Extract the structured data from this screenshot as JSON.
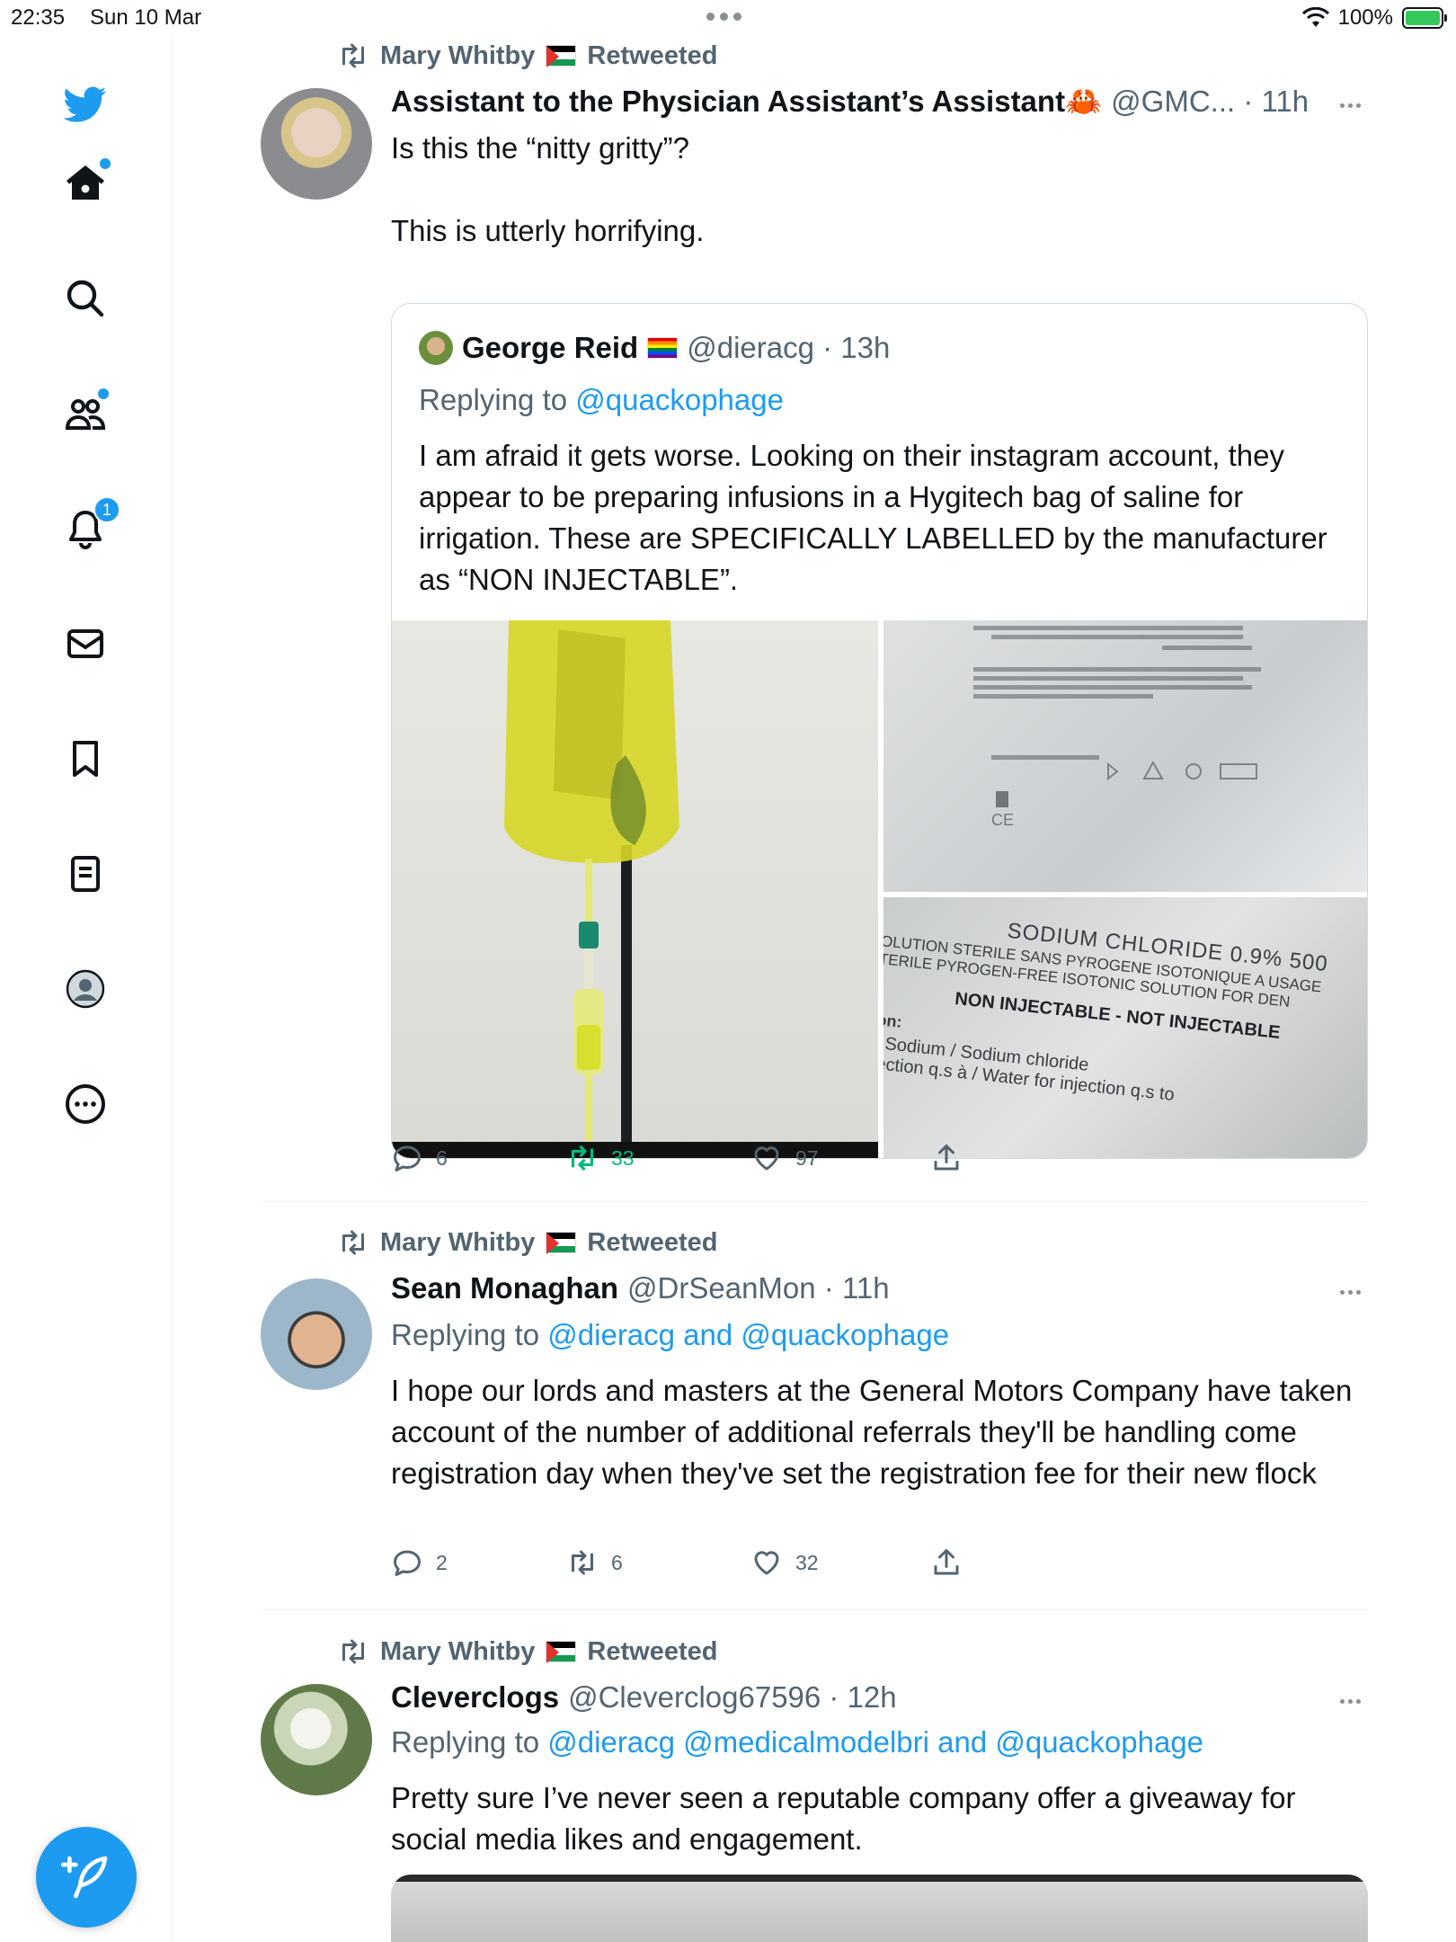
{
  "status_bar": {
    "time": "22:35",
    "date": "Sun 10 Mar",
    "battery": "100%"
  },
  "sidebar": {
    "items": [
      {
        "name": "twitter-logo-icon"
      },
      {
        "name": "home-icon"
      },
      {
        "name": "search-icon"
      },
      {
        "name": "communities-icon"
      },
      {
        "name": "notifications-icon",
        "badge": "1"
      },
      {
        "name": "messages-icon"
      },
      {
        "name": "bookmarks-icon"
      },
      {
        "name": "lists-icon"
      },
      {
        "name": "profile-icon"
      },
      {
        "name": "more-icon"
      }
    ],
    "accent": "#1d9bf0"
  },
  "tweets": [
    {
      "retweeted_by": "Mary Whitby",
      "retweeted_label": "Retweeted",
      "name": "Assistant to the Physician Assistant’s Assistant🦀",
      "meta": "@GMC... · 11h",
      "text_lines": [
        "Is this the “nitty gritty”?",
        "",
        "This is utterly horrifying."
      ],
      "quote": {
        "name": "George Reid",
        "meta": "@dieracg · 13h",
        "replying_prefix": "Replying to",
        "replying_to": "@quackophage",
        "text": "I am afraid it gets worse. Looking on their instagram account, they appear to be preparing infusions in a Hygitech bag of saline for irrigation. These are SPECIFICALLY LABELLED by the manufacturer as “NON INJECTABLE”.",
        "media_text": {
          "label_a": "SODIUM CHLORIDE 0.9% 500",
          "label_b": "SOLUTION STERILE SANS PYROGENE ISOTONIQUE A USAGE",
          "label_c": "STERILE PYROGEN-FREE ISOTONIC SOLUTION FOR DEN",
          "label_d": "NON INJECTABLE - NOT INJECTABLE",
          "label_e": "ition:",
          "label_f": "de Sodium / Sodium chloride",
          "label_g": "injection q.s à / Water for injection q.s to"
        }
      },
      "actions": {
        "replies": "6",
        "retweets": "33",
        "likes": "97"
      }
    },
    {
      "retweeted_by": "Mary Whitby",
      "retweeted_label": "Retweeted",
      "name": "Sean Monaghan",
      "meta": "@DrSeanMon · 11h",
      "replying_prefix": "Replying to",
      "replying_to": "@dieracg and @quackophage",
      "text": "I hope our lords and masters at the General Motors Company have taken account of the number of additional referrals they'll be handling come registration day when they've set the registration fee for their new flock",
      "actions": {
        "replies": "2",
        "retweets": "6",
        "likes": "32"
      }
    },
    {
      "retweeted_by": "Mary Whitby",
      "retweeted_label": "Retweeted",
      "name": "Cleverclogs",
      "meta": "@Cleverclog67596 · 12h",
      "replying_prefix": "Replying to",
      "replying_to": "@dieracg @medicalmodelbri and @quackophage",
      "text": "Pretty sure I’ve never seen a reputable company offer a giveaway for social media likes and engagement."
    }
  ]
}
